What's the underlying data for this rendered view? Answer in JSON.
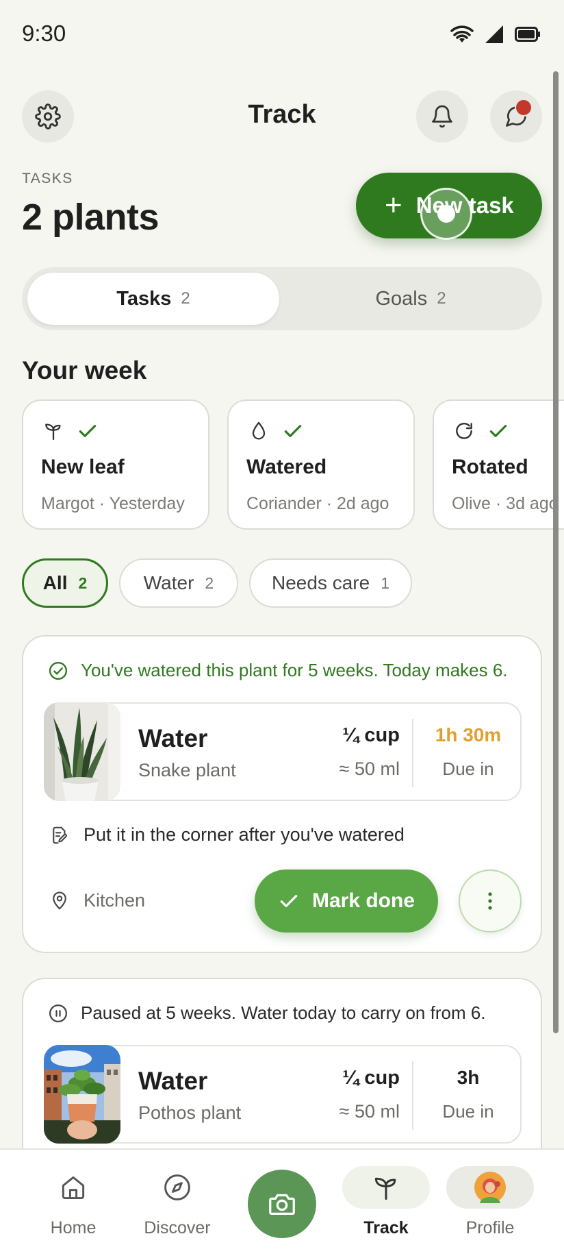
{
  "status_bar": {
    "time": "9:30"
  },
  "header": {
    "title": "Track"
  },
  "summary": {
    "label": "TASKS",
    "count_text": "2 plants"
  },
  "new_task_button": {
    "label": "New task"
  },
  "segmented": {
    "tabs": [
      {
        "label": "Tasks",
        "count": "2"
      },
      {
        "label": "Goals",
        "count": "2"
      }
    ]
  },
  "week": {
    "title": "Your week",
    "cards": [
      {
        "title": "New leaf",
        "subtitle": "Margot · Yesterday",
        "icon": "sprout-icon"
      },
      {
        "title": "Watered",
        "subtitle": "Coriander · 2d ago",
        "icon": "droplet-icon"
      },
      {
        "title": "Rotated",
        "subtitle": "Olive · 3d ago",
        "icon": "rotate-icon"
      }
    ]
  },
  "filters": [
    {
      "label": "All",
      "count": "2"
    },
    {
      "label": "Water",
      "count": "2"
    },
    {
      "label": "Needs care",
      "count": "1"
    }
  ],
  "tasks": [
    {
      "streak": "You've watered this plant for 5 weeks. Today makes 6.",
      "title": "Water",
      "plant": "Snake plant",
      "amount": "¼ cup",
      "amount_ml": "≈ 50 ml",
      "due": "1h 30m",
      "due_label": "Due in",
      "note": "Put it in the corner after you've watered",
      "location": "Kitchen",
      "action": "Mark done"
    },
    {
      "streak": "Paused at 5 weeks. Water today to carry on from 6.",
      "title": "Water",
      "plant": "Pothos plant",
      "amount": "¼ cup",
      "amount_ml": "≈ 50 ml",
      "due": "3h",
      "due_label": "Due in"
    }
  ],
  "bottom_nav": {
    "items": [
      {
        "label": "Home"
      },
      {
        "label": "Discover"
      },
      {
        "label": "Track"
      },
      {
        "label": "Profile"
      }
    ]
  },
  "colors": {
    "primary_green": "#2f7a1f",
    "action_green": "#5aa845",
    "due_orange": "#e0a030",
    "notification_red": "#c2382b"
  }
}
